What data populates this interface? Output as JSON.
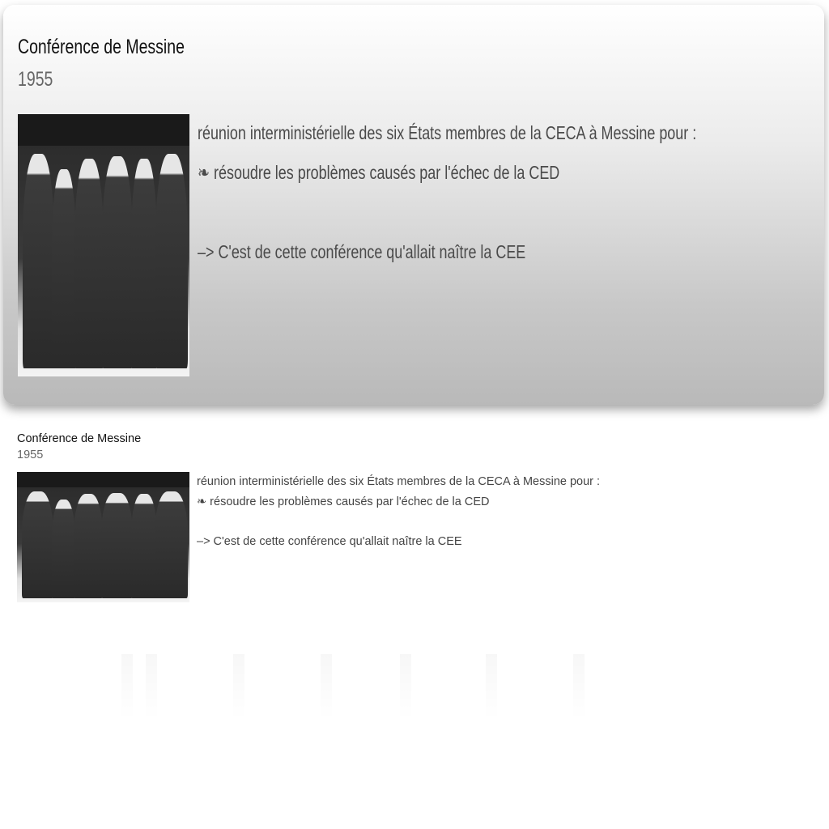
{
  "card": {
    "title": "Conférence de Messine",
    "year": "1955",
    "image_icon": "photo-of-six-ministers",
    "lines": [
      "réunion interministérielle des six États membres de la CECA à Messine pour :",
      "❧ résoudre les problèmes causés par l'échec de la CED",
      "",
      "–> C'est de cette conférence qu'allait naître la CEE"
    ]
  },
  "colors": {
    "title": "#111111",
    "year": "#666666",
    "body": "#444444"
  }
}
